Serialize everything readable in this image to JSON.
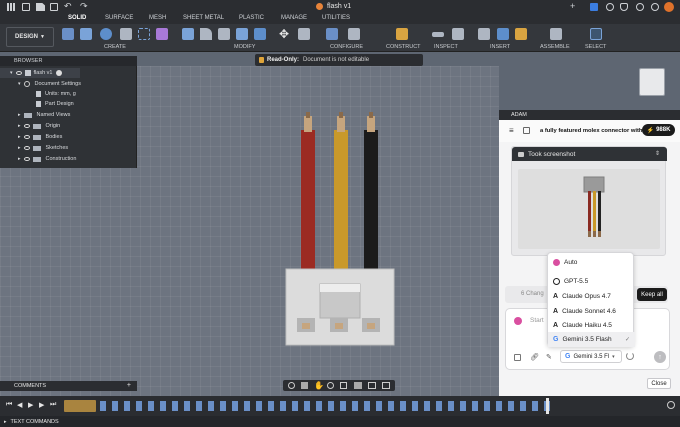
{
  "titlebar": {
    "file_title": "flash v1"
  },
  "ribbon": {
    "tabs": [
      "SOLID",
      "SURFACE",
      "MESH",
      "SHEET METAL",
      "PLASTIC",
      "MANAGE",
      "UTILITIES"
    ],
    "workspace": "DESIGN",
    "groups": [
      "CREATE",
      "MODIFY",
      "CONFIGURE",
      "CONSTRUCT",
      "INSPECT",
      "INSERT",
      "ASSEMBLE",
      "SELECT"
    ]
  },
  "info_bar": {
    "read_only_label": "Read-Only:",
    "read_only_msg": "Document is not editable"
  },
  "browser": {
    "title": "BROWSER",
    "root": "flash v1",
    "items": [
      {
        "label": "Document Settings"
      },
      {
        "label": "Units: mm, g"
      },
      {
        "label": "Part Design"
      },
      {
        "label": "Named Views"
      },
      {
        "label": "Origin"
      },
      {
        "label": "Bodies"
      },
      {
        "label": "Sketches"
      },
      {
        "label": "Construction"
      }
    ]
  },
  "comments": {
    "label": "COMMENTS"
  },
  "text_commands": {
    "label": "TEXT COMMANDS"
  },
  "adam": {
    "title": "ADAM",
    "chat_title": "a fully featured molex connector with",
    "credits": "988K",
    "tool_card": {
      "label": "Took screenshot"
    },
    "changes_partial": "6 Chang",
    "keep_all": "Keep all",
    "input_placeholder": "Start",
    "model_selected": "Gemini 3.5 Fl",
    "close": "Close",
    "models": [
      "Auto",
      "GPT-5.5",
      "Claude Opus 4.7",
      "Claude Sonnet 4.6",
      "Claude Haiku 4.5",
      "Gemini 3.5 Flash"
    ]
  },
  "colors": {
    "wire_red": "#9b2b22",
    "wire_yellow": "#c9992a",
    "wire_black": "#1b1b1b",
    "housing": "#dcdcdc",
    "pin": "#c6a57e"
  }
}
